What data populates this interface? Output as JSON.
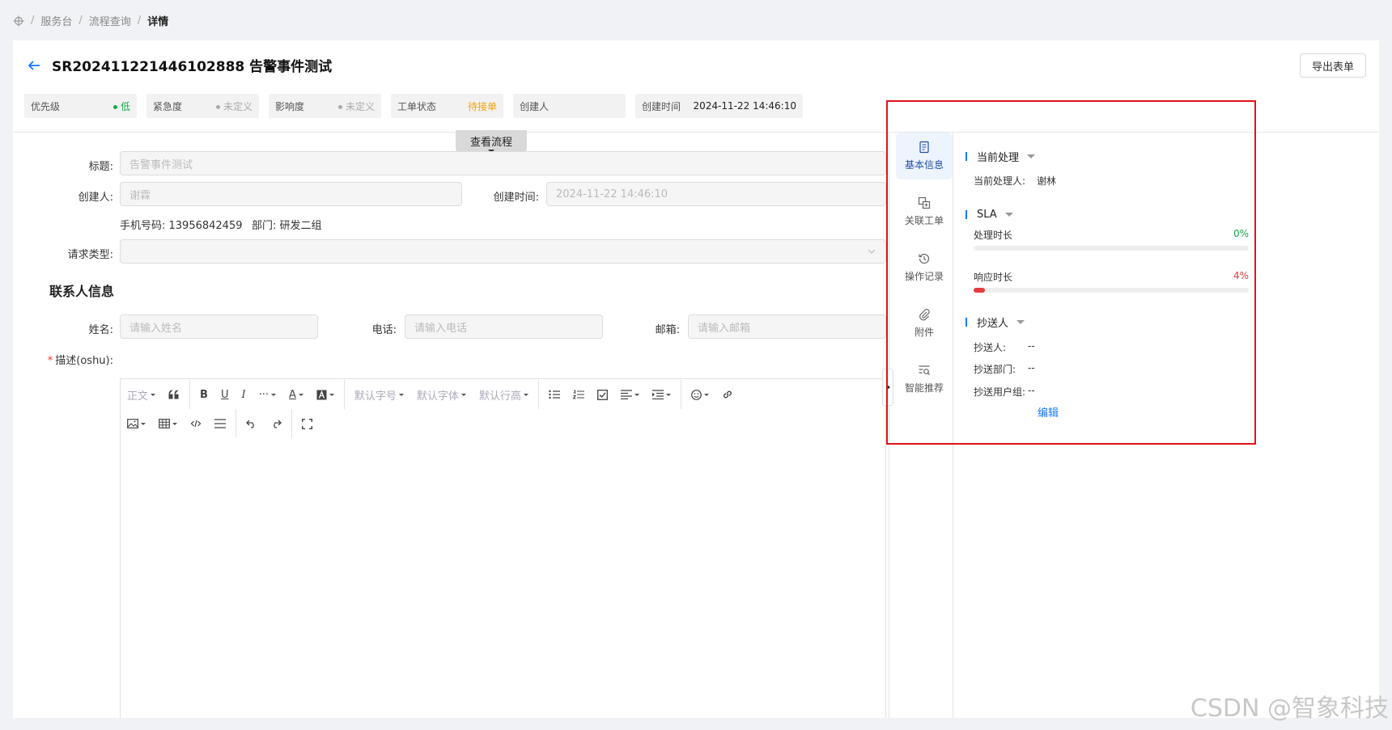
{
  "breadcrumb": {
    "items": [
      "服务台",
      "流程查询",
      "详情"
    ],
    "separator": "/"
  },
  "header": {
    "title": "SR202411221446102888 告警事件测试",
    "export_label": "导出表单"
  },
  "meta": {
    "priority": {
      "label": "优先级",
      "value": "低",
      "color": "#19a84a"
    },
    "urgency": {
      "label": "紧急度",
      "value": "未定义",
      "color": "#aaaaaa"
    },
    "impact": {
      "label": "影响度",
      "value": "未定义",
      "color": "#aaaaaa"
    },
    "status": {
      "label": "工单状态",
      "value": "待接单",
      "color": "#f5a10b"
    },
    "creator": {
      "label": "创建人",
      "value": ""
    },
    "created_time": {
      "label": "创建时间",
      "value": "2024-11-22 14:46:10"
    }
  },
  "flow_button": "查看流程",
  "form": {
    "title_label": "标题:",
    "title_value": "告警事件测试",
    "creator_label": "创建人:",
    "creator_value": "谢霖",
    "created_time_label": "创建时间:",
    "created_time_value": "2024-11-22 14:46:10",
    "phone_text": "手机号码:  13956842459",
    "dept_text": "部门:  研发二组",
    "request_type_label": "请求类型:",
    "contact_section": "联系人信息",
    "name_label": "姓名:",
    "name_placeholder": "请输入姓名",
    "tel_label": "电话:",
    "tel_placeholder": "请输入电话",
    "email_label": "邮箱:",
    "email_placeholder": "请输入邮箱",
    "desc_required": "*",
    "desc_label": "描述(oshu):"
  },
  "editor_toolbar": {
    "paragraph": "正文",
    "font_size": "默认字号",
    "font_family": "默认字体",
    "line_height": "默认行高"
  },
  "side_nav": {
    "items": [
      {
        "label": "基本信息",
        "icon": "document-icon",
        "active": true
      },
      {
        "label": "关联工单",
        "icon": "link-tickets-icon",
        "active": false
      },
      {
        "label": "操作记录",
        "icon": "history-icon",
        "active": false
      },
      {
        "label": "附件",
        "icon": "paperclip-icon",
        "active": false
      },
      {
        "label": "智能推荐",
        "icon": "smart-search-icon",
        "active": false
      }
    ]
  },
  "panel": {
    "current": {
      "title": "当前处理",
      "handler_label": "当前处理人:",
      "handler_value": "谢林"
    },
    "sla": {
      "title": "SLA",
      "process_label": "处理时长",
      "process_pct_text": "0%",
      "process_pct": 0,
      "process_color": "#19a84a",
      "response_label": "响应时长",
      "response_pct_text": "4%",
      "response_pct": 4,
      "response_color": "#e33d3d"
    },
    "cc": {
      "title": "抄送人",
      "person_label": "抄送人:",
      "person_value": "--",
      "dept_label": "抄送部门:",
      "dept_value": "--",
      "group_label": "抄送用户组:",
      "group_value": "--",
      "edit_label": "编辑"
    }
  },
  "watermark": "CSDN @智象科技"
}
